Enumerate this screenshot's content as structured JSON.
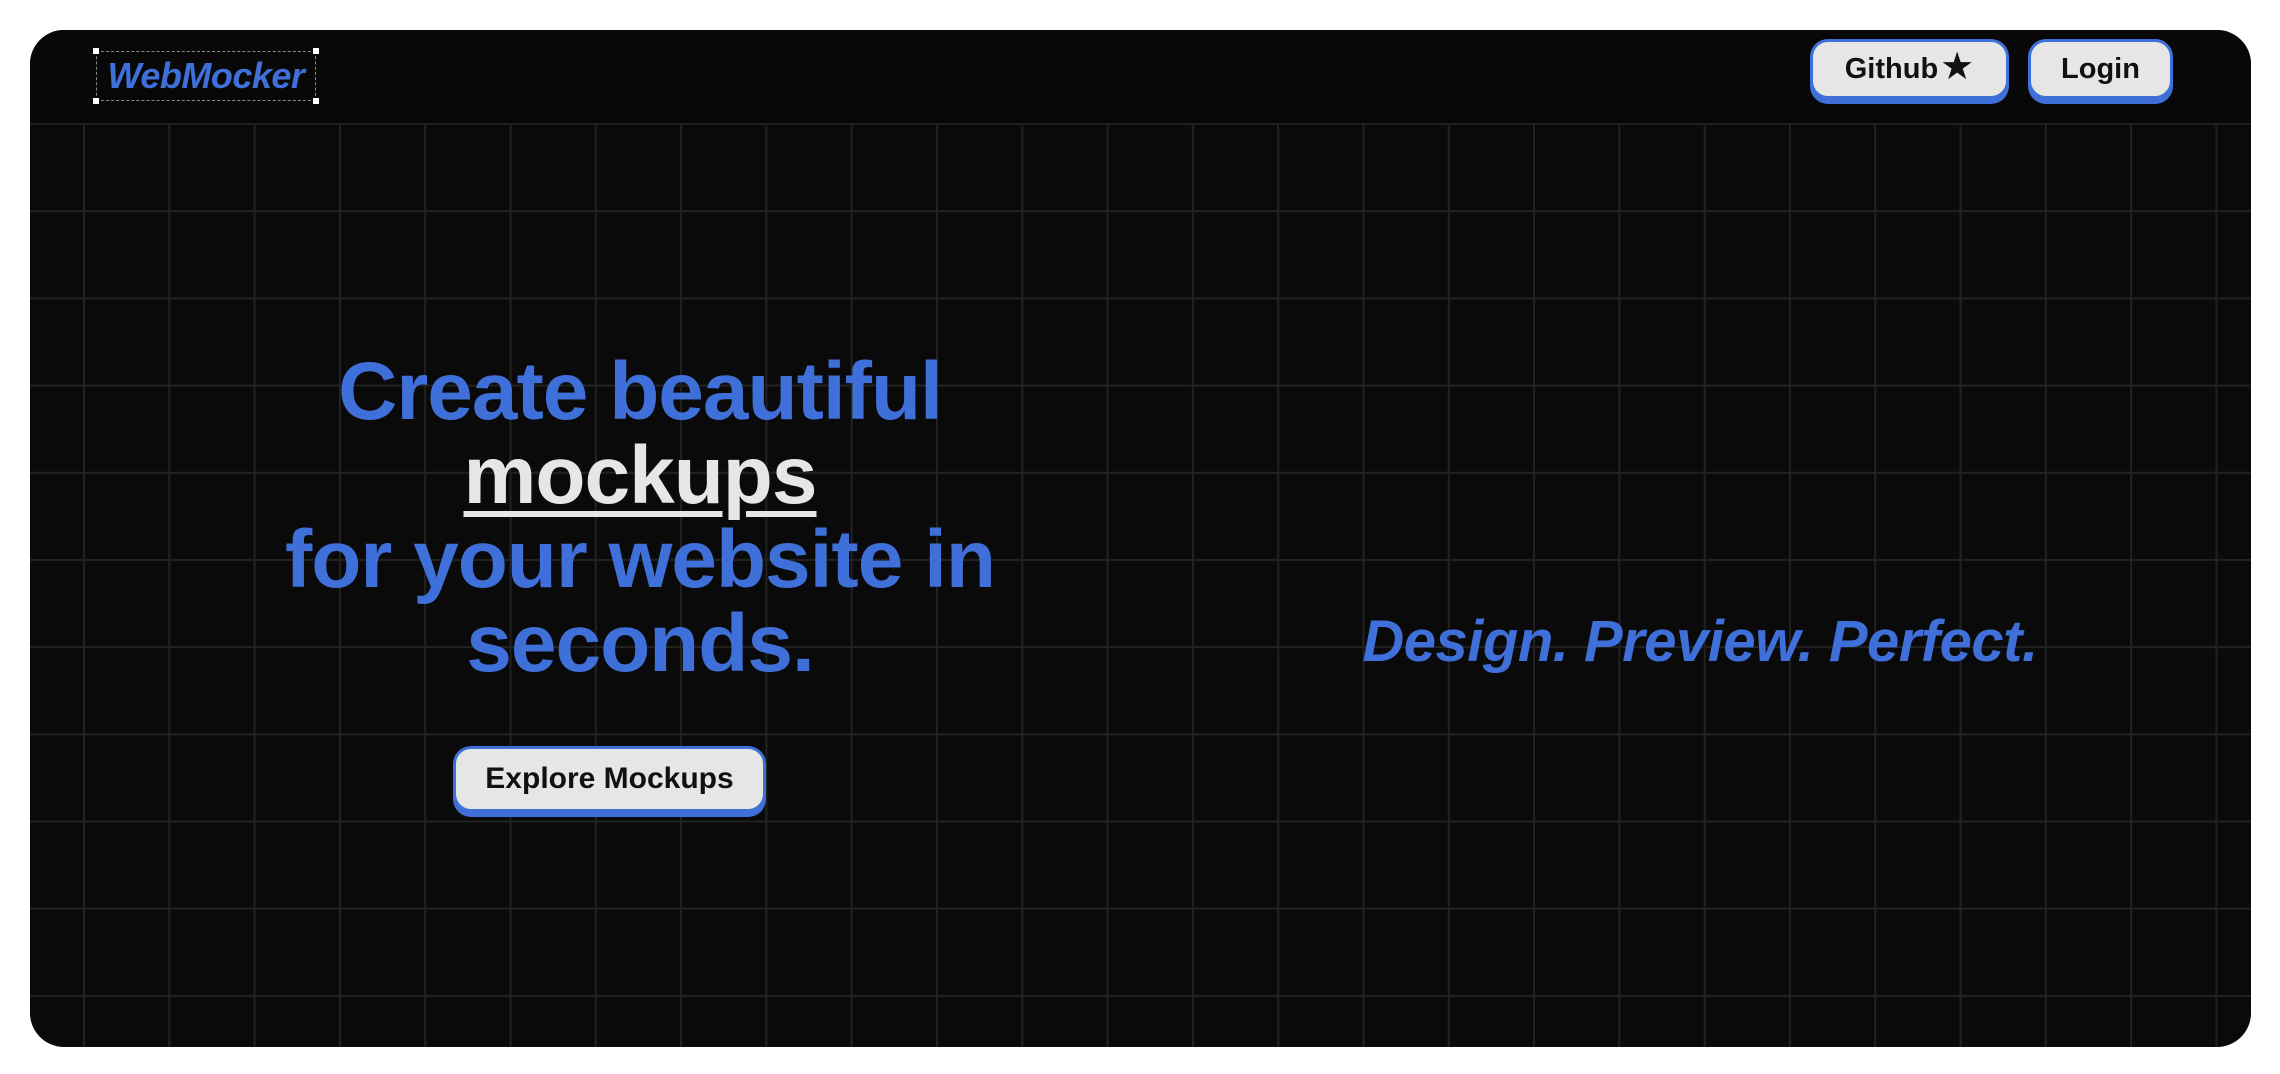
{
  "nav": {
    "logo": "WebMocker",
    "github_label": "Github",
    "github_icon": "star-icon",
    "login_label": "Login"
  },
  "hero": {
    "line1": "Create beautiful",
    "highlight": "mockups",
    "line3": "for your website in",
    "line4": "seconds.",
    "cta_label": "Explore Mockups"
  },
  "tagline": "Design. Preview. Perfect.",
  "colors": {
    "accent": "#3f6fd8",
    "background": "#0a0a0a",
    "button_bg": "#e6e6e6",
    "highlight_text": "#e6e6e6"
  }
}
